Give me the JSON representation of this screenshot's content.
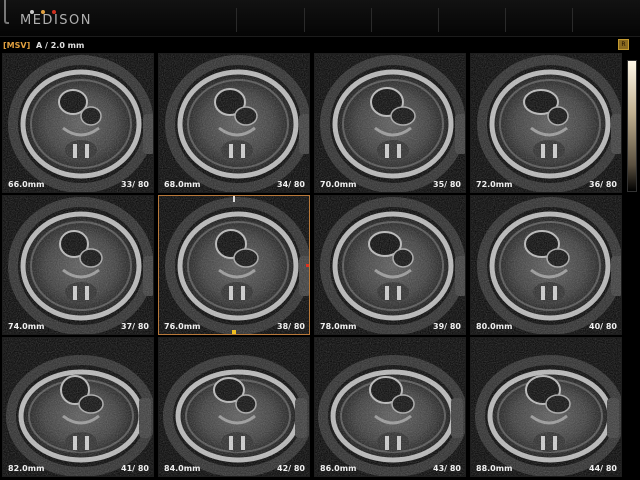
{
  "header": {
    "logo_text": "MEDISON",
    "logo_dots": [
      "#c8c8c8",
      "#e0a040",
      "#d03020"
    ]
  },
  "info": {
    "mode_tag": "[MSV]",
    "mode_spec": "A / 2.0 mm"
  },
  "status_icon": "R",
  "active_slice_index": 5,
  "slices": [
    {
      "depth": "66.0mm",
      "index": "33/ 80"
    },
    {
      "depth": "68.0mm",
      "index": "34/ 80"
    },
    {
      "depth": "70.0mm",
      "index": "35/ 80"
    },
    {
      "depth": "72.0mm",
      "index": "36/ 80"
    },
    {
      "depth": "74.0mm",
      "index": "37/ 80"
    },
    {
      "depth": "76.0mm",
      "index": "38/ 80"
    },
    {
      "depth": "78.0mm",
      "index": "39/ 80"
    },
    {
      "depth": "80.0mm",
      "index": "40/ 80"
    },
    {
      "depth": "82.0mm",
      "index": "41/ 80"
    },
    {
      "depth": "84.0mm",
      "index": "42/ 80"
    },
    {
      "depth": "86.0mm",
      "index": "43/ 80"
    },
    {
      "depth": "88.0mm",
      "index": "44/ 80"
    }
  ]
}
